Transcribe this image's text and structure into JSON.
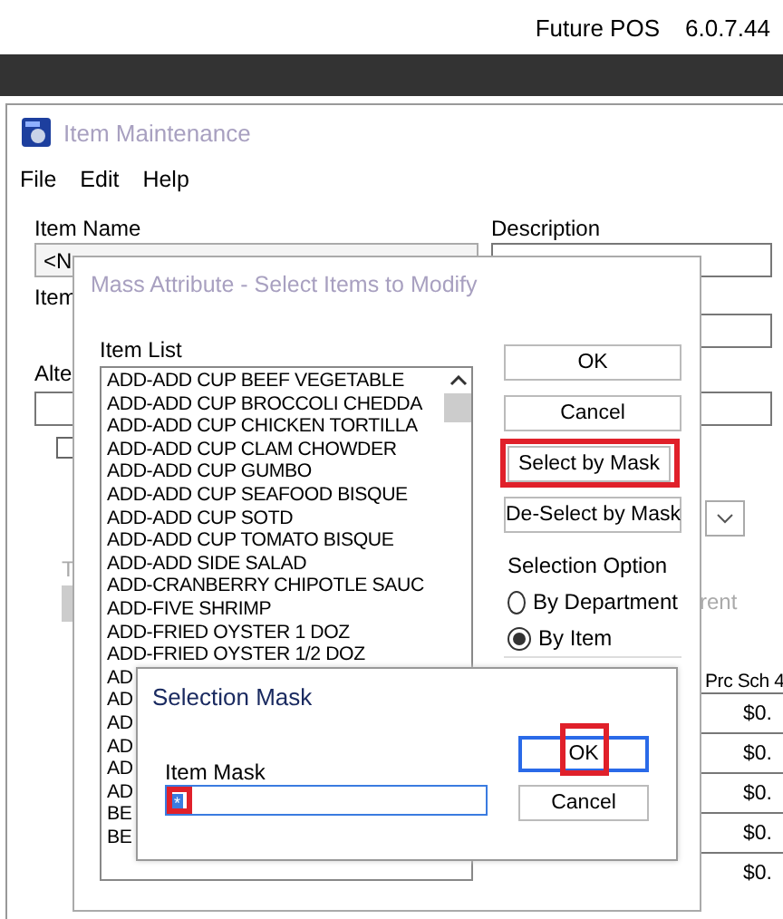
{
  "app_header": {
    "title": "Future POS",
    "version": "6.0.7.44"
  },
  "item_maintenance": {
    "title": "Item Maintenance",
    "menu": [
      "File",
      "Edit",
      "Help"
    ],
    "item_name": {
      "label": "Item Name",
      "value": "<N"
    },
    "description": {
      "label": "Description"
    },
    "fragments": {
      "item": "Item",
      "alternate": "Alte",
      "t": "T",
      "current": "rent"
    },
    "checkbox": {
      "checked": false
    },
    "price_header": "Prc Sch 4",
    "prices": [
      "$0.",
      "$0.",
      "$0.",
      "$0.",
      "$0."
    ]
  },
  "mass_attribute": {
    "title": "Mass Attribute - Select Items to Modify",
    "list_label": "Item List",
    "items": [
      "ADD-ADD CUP BEEF VEGETABLE",
      "ADD-ADD CUP BROCCOLI CHEDDA",
      "ADD-ADD CUP CHICKEN TORTILLA",
      "ADD-ADD CUP CLAM CHOWDER",
      "ADD-ADD CUP GUMBO",
      "ADD-ADD CUP SEAFOOD BISQUE",
      "ADD-ADD CUP SOTD",
      "ADD-ADD CUP TOMATO BISQUE",
      "ADD-ADD SIDE SALAD",
      "ADD-CRANBERRY CHIPOTLE SAUC",
      "ADD-FIVE SHRIMP",
      "ADD-FRIED OYSTER 1 DOZ",
      "ADD-FRIED OYSTER 1/2 DOZ",
      "AD",
      "AD",
      "AD",
      "AD",
      "AD",
      "AD",
      "BE",
      "BE"
    ],
    "buttons": [
      {
        "label": "OK",
        "highlighted": false
      },
      {
        "label": "Cancel",
        "highlighted": false
      },
      {
        "label": "Select by Mask",
        "highlighted": true
      },
      {
        "label": "De-Select by Mask",
        "highlighted": false
      }
    ],
    "selection_option": {
      "label": "Selection Option",
      "options": [
        {
          "label": "By Department",
          "selected": false
        },
        {
          "label": "By Item",
          "selected": true
        }
      ]
    }
  },
  "selection_mask": {
    "title": "Selection Mask",
    "field": {
      "label": "Item Mask",
      "value": "*",
      "text_selected": true,
      "highlighted": true
    },
    "buttons": [
      {
        "label": "OK",
        "focused": true,
        "highlighted": true
      },
      {
        "label": "Cancel",
        "focused": false,
        "highlighted": false
      }
    ]
  }
}
